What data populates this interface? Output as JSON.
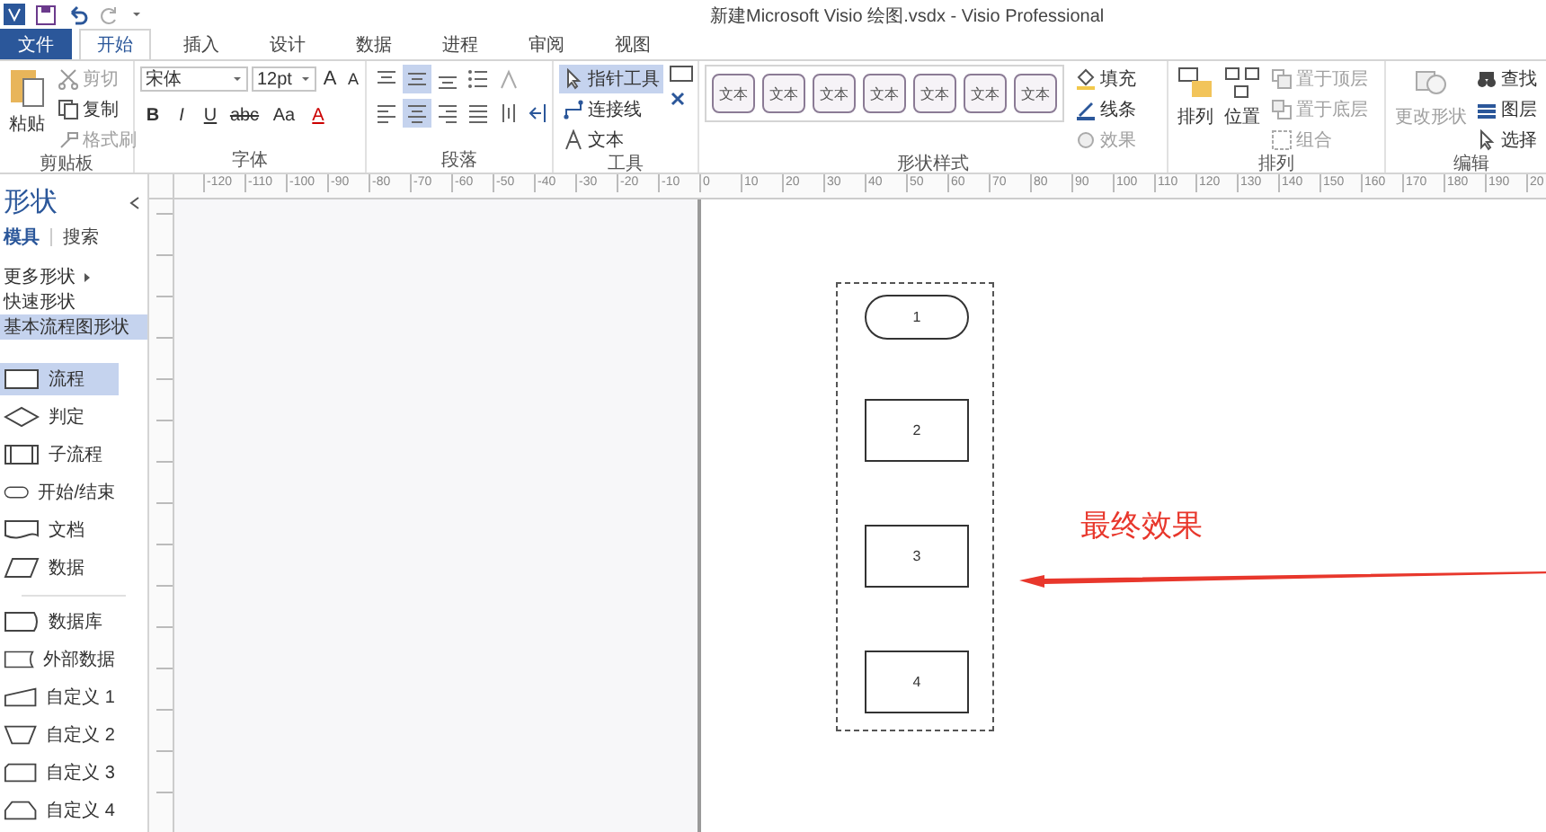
{
  "window": {
    "title": "新建Microsoft Visio 绘图.vsdx - Visio Professional"
  },
  "tabs": [
    {
      "label": "文件",
      "kind": "file",
      "selected": false
    },
    {
      "label": "开始",
      "kind": "tab",
      "selected": true
    },
    {
      "label": "插入",
      "kind": "tab",
      "selected": false
    },
    {
      "label": "设计",
      "kind": "tab",
      "selected": false
    },
    {
      "label": "数据",
      "kind": "tab",
      "selected": false
    },
    {
      "label": "进程",
      "kind": "tab",
      "selected": false
    },
    {
      "label": "审阅",
      "kind": "tab",
      "selected": false
    },
    {
      "label": "视图",
      "kind": "tab",
      "selected": false
    }
  ],
  "ribbon": {
    "clipboard": {
      "label": "剪贴板",
      "paste": "粘贴",
      "items": [
        {
          "label": "剪切",
          "kind": "cut",
          "disabled": true
        },
        {
          "label": "复制",
          "kind": "copy",
          "disabled": false
        },
        {
          "label": "格式刷",
          "kind": "brush",
          "disabled": true
        }
      ]
    },
    "font": {
      "label": "字体",
      "font_name": "宋体",
      "font_size": "12pt",
      "size_buttons": [
        "A",
        "A"
      ],
      "style_buttons": [
        {
          "label": "B",
          "kind": "bold"
        },
        {
          "label": "I",
          "kind": "italic"
        },
        {
          "label": "U",
          "kind": "underline"
        },
        {
          "label": "abc",
          "kind": "strike"
        },
        {
          "label": "Aa",
          "kind": "case"
        }
      ],
      "color_button": "A"
    },
    "paragraph": {
      "label": "段落",
      "rows": [
        [
          {
            "kind": "align-top",
            "selected": false
          },
          {
            "kind": "align-middle",
            "selected": true
          },
          {
            "kind": "align-bottom",
            "selected": false
          },
          {
            "kind": "bullets",
            "selected": false
          },
          {
            "kind": "text-size",
            "selected": false
          }
        ],
        [
          {
            "kind": "align-left",
            "selected": false
          },
          {
            "kind": "align-center",
            "selected": true
          },
          {
            "kind": "align-right",
            "selected": false
          },
          {
            "kind": "justify",
            "selected": false
          },
          {
            "kind": "text-direction",
            "selected": false
          },
          {
            "kind": "indent",
            "selected": false
          }
        ]
      ]
    },
    "tools": {
      "label": "工具",
      "items": [
        {
          "label": "指针工具",
          "kind": "pointer",
          "selected": true
        },
        {
          "label": "连接线",
          "kind": "connector",
          "selected": false
        },
        {
          "label": "文本",
          "kind": "text",
          "selected": false
        }
      ]
    },
    "shape_styles": {
      "label": "形状样式",
      "styles": [
        "文本",
        "文本",
        "文本",
        "文本",
        "文本",
        "文本",
        "文本"
      ],
      "options": [
        {
          "label": "填充",
          "kind": "fill",
          "disabled": false
        },
        {
          "label": "线条",
          "kind": "line",
          "disabled": false
        },
        {
          "label": "效果",
          "kind": "effect",
          "disabled": true
        }
      ]
    },
    "arrange": {
      "label": "排列",
      "big": [
        {
          "label": "排列",
          "kind": "arrange"
        },
        {
          "label": "位置",
          "kind": "position"
        }
      ],
      "items": [
        {
          "label": "置于顶层",
          "kind": "front",
          "disabled": true
        },
        {
          "label": "置于底层",
          "kind": "back",
          "disabled": true
        },
        {
          "label": "组合",
          "kind": "group",
          "disabled": true
        }
      ]
    },
    "editing": {
      "label": "编辑",
      "change_shape": {
        "label": "更改形状",
        "disabled": true
      },
      "items": [
        {
          "label": "查找",
          "kind": "find",
          "disabled": false
        },
        {
          "label": "图层",
          "kind": "layers",
          "disabled": false
        },
        {
          "label": "选择",
          "kind": "select",
          "disabled": false
        }
      ]
    }
  },
  "sidebar": {
    "title": "形状",
    "tabs": [
      {
        "label": "模具",
        "selected": true
      },
      {
        "label": "搜索",
        "selected": false
      }
    ],
    "stencils": [
      {
        "label": "更多形状",
        "kind": "more",
        "selected": false
      },
      {
        "label": "快速形状",
        "kind": "plain",
        "selected": false
      },
      {
        "label": "基本流程图形状",
        "kind": "plain",
        "selected": true
      }
    ],
    "shape_sections": [
      {
        "items": [
          {
            "label": "流程",
            "kind": "process",
            "selected": true
          },
          {
            "label": "判定",
            "kind": "decision",
            "selected": false
          },
          {
            "label": "子流程",
            "kind": "subprocess",
            "selected": false
          },
          {
            "label": "开始/结束",
            "kind": "terminator",
            "selected": false
          },
          {
            "label": "文档",
            "kind": "document",
            "selected": false
          },
          {
            "label": "数据",
            "kind": "data",
            "selected": false
          }
        ]
      },
      {
        "items": [
          {
            "label": "数据库",
            "kind": "database",
            "selected": false
          },
          {
            "label": "外部数据",
            "kind": "external",
            "selected": false
          },
          {
            "label": "自定义 1",
            "kind": "custom1",
            "selected": false
          },
          {
            "label": "自定义 2",
            "kind": "custom2",
            "selected": false
          },
          {
            "label": "自定义 3",
            "kind": "custom3",
            "selected": false
          },
          {
            "label": "自定义 4",
            "kind": "custom4",
            "selected": false
          }
        ]
      }
    ]
  },
  "ruler": {
    "labels": [
      "-120",
      "-110",
      "-100",
      "-90",
      "-80",
      "-70",
      "-60",
      "-50",
      "-40",
      "-30",
      "-20",
      "-10",
      "0",
      "10",
      "20",
      "30",
      "40",
      "50",
      "60",
      "70",
      "80",
      "90",
      "100",
      "110",
      "120",
      "130",
      "140",
      "150",
      "160",
      "170",
      "180",
      "190",
      "20"
    ]
  },
  "diagram": {
    "nodes": [
      {
        "label": "1",
        "kind": "terminator"
      },
      {
        "label": "2",
        "kind": "process"
      },
      {
        "label": "3",
        "kind": "process"
      },
      {
        "label": "4",
        "kind": "process"
      }
    ],
    "annotation": {
      "text": "最终效果",
      "color": "#e8372c"
    }
  }
}
